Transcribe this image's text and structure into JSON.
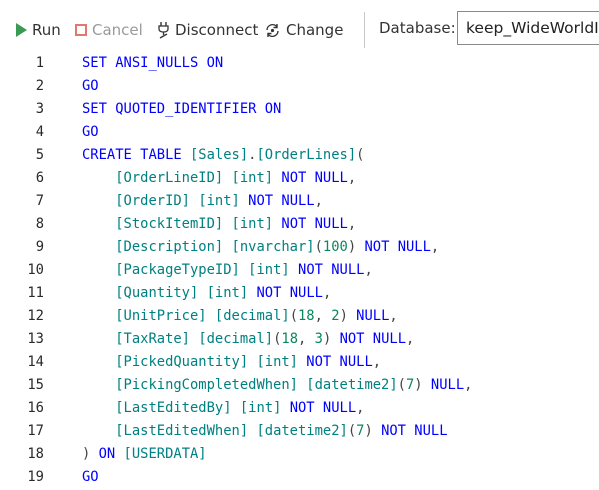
{
  "toolbar": {
    "run_label": "Run",
    "cancel_label": "Cancel",
    "disconnect_label": "Disconnect",
    "change_label": "Change",
    "database_label": "Database:",
    "database_value": "keep_WideWorldI"
  },
  "icons": {
    "run": "play-icon",
    "cancel": "stop-square-icon",
    "disconnect": "plug-disconnect-icon",
    "change": "connection-change-icon"
  },
  "colors": {
    "keyword": "#0000ff",
    "identifier": "#008080",
    "number": "#09885a",
    "run_icon": "#3a9a53",
    "cancel_icon": "#e2776e"
  },
  "editor": {
    "lines": [
      {
        "n": "1",
        "indent": "",
        "tokens": [
          {
            "t": "kw",
            "v": "SET ANSI_NULLS ON"
          }
        ]
      },
      {
        "n": "2",
        "indent": "",
        "tokens": [
          {
            "t": "kw",
            "v": "GO"
          }
        ]
      },
      {
        "n": "3",
        "indent": "",
        "tokens": [
          {
            "t": "kw",
            "v": "SET QUOTED_IDENTIFIER ON"
          }
        ]
      },
      {
        "n": "4",
        "indent": "",
        "tokens": [
          {
            "t": "kw",
            "v": "GO"
          }
        ]
      },
      {
        "n": "5",
        "indent": "",
        "tokens": [
          {
            "t": "kw",
            "v": "CREATE TABLE "
          },
          {
            "t": "id",
            "v": "[Sales]"
          },
          {
            "t": "pun",
            "v": "."
          },
          {
            "t": "id",
            "v": "[OrderLines]"
          },
          {
            "t": "pun",
            "v": "("
          }
        ]
      },
      {
        "n": "6",
        "indent": "    ",
        "tokens": [
          {
            "t": "id",
            "v": "[OrderLineID]"
          },
          {
            "t": "pun",
            "v": " "
          },
          {
            "t": "id",
            "v": "[int]"
          },
          {
            "t": "kw",
            "v": " NOT NULL"
          },
          {
            "t": "pun",
            "v": ","
          }
        ]
      },
      {
        "n": "7",
        "indent": "    ",
        "tokens": [
          {
            "t": "id",
            "v": "[OrderID]"
          },
          {
            "t": "pun",
            "v": " "
          },
          {
            "t": "id",
            "v": "[int]"
          },
          {
            "t": "kw",
            "v": " NOT NULL"
          },
          {
            "t": "pun",
            "v": ","
          }
        ]
      },
      {
        "n": "8",
        "indent": "    ",
        "tokens": [
          {
            "t": "id",
            "v": "[StockItemID]"
          },
          {
            "t": "pun",
            "v": " "
          },
          {
            "t": "id",
            "v": "[int]"
          },
          {
            "t": "kw",
            "v": " NOT NULL"
          },
          {
            "t": "pun",
            "v": ","
          }
        ]
      },
      {
        "n": "9",
        "indent": "    ",
        "tokens": [
          {
            "t": "id",
            "v": "[Description]"
          },
          {
            "t": "pun",
            "v": " "
          },
          {
            "t": "id",
            "v": "[nvarchar]"
          },
          {
            "t": "pun",
            "v": "("
          },
          {
            "t": "num",
            "v": "100"
          },
          {
            "t": "pun",
            "v": ")"
          },
          {
            "t": "kw",
            "v": " NOT NULL"
          },
          {
            "t": "pun",
            "v": ","
          }
        ]
      },
      {
        "n": "10",
        "indent": "    ",
        "tokens": [
          {
            "t": "id",
            "v": "[PackageTypeID]"
          },
          {
            "t": "pun",
            "v": " "
          },
          {
            "t": "id",
            "v": "[int]"
          },
          {
            "t": "kw",
            "v": " NOT NULL"
          },
          {
            "t": "pun",
            "v": ","
          }
        ]
      },
      {
        "n": "11",
        "indent": "    ",
        "tokens": [
          {
            "t": "id",
            "v": "[Quantity]"
          },
          {
            "t": "pun",
            "v": " "
          },
          {
            "t": "id",
            "v": "[int]"
          },
          {
            "t": "kw",
            "v": " NOT NULL"
          },
          {
            "t": "pun",
            "v": ","
          }
        ]
      },
      {
        "n": "12",
        "indent": "    ",
        "tokens": [
          {
            "t": "id",
            "v": "[UnitPrice]"
          },
          {
            "t": "pun",
            "v": " "
          },
          {
            "t": "id",
            "v": "[decimal]"
          },
          {
            "t": "pun",
            "v": "("
          },
          {
            "t": "num",
            "v": "18"
          },
          {
            "t": "pun",
            "v": ", "
          },
          {
            "t": "num",
            "v": "2"
          },
          {
            "t": "pun",
            "v": ")"
          },
          {
            "t": "kw",
            "v": " NULL"
          },
          {
            "t": "pun",
            "v": ","
          }
        ]
      },
      {
        "n": "13",
        "indent": "    ",
        "tokens": [
          {
            "t": "id",
            "v": "[TaxRate]"
          },
          {
            "t": "pun",
            "v": " "
          },
          {
            "t": "id",
            "v": "[decimal]"
          },
          {
            "t": "pun",
            "v": "("
          },
          {
            "t": "num",
            "v": "18"
          },
          {
            "t": "pun",
            "v": ", "
          },
          {
            "t": "num",
            "v": "3"
          },
          {
            "t": "pun",
            "v": ")"
          },
          {
            "t": "kw",
            "v": " NOT NULL"
          },
          {
            "t": "pun",
            "v": ","
          }
        ]
      },
      {
        "n": "14",
        "indent": "    ",
        "tokens": [
          {
            "t": "id",
            "v": "[PickedQuantity]"
          },
          {
            "t": "pun",
            "v": " "
          },
          {
            "t": "id",
            "v": "[int]"
          },
          {
            "t": "kw",
            "v": " NOT NULL"
          },
          {
            "t": "pun",
            "v": ","
          }
        ]
      },
      {
        "n": "15",
        "indent": "    ",
        "tokens": [
          {
            "t": "id",
            "v": "[PickingCompletedWhen]"
          },
          {
            "t": "pun",
            "v": " "
          },
          {
            "t": "id",
            "v": "[datetime2]"
          },
          {
            "t": "pun",
            "v": "("
          },
          {
            "t": "num",
            "v": "7"
          },
          {
            "t": "pun",
            "v": ")"
          },
          {
            "t": "kw",
            "v": " NULL"
          },
          {
            "t": "pun",
            "v": ","
          }
        ]
      },
      {
        "n": "16",
        "indent": "    ",
        "tokens": [
          {
            "t": "id",
            "v": "[LastEditedBy]"
          },
          {
            "t": "pun",
            "v": " "
          },
          {
            "t": "id",
            "v": "[int]"
          },
          {
            "t": "kw",
            "v": " NOT NULL"
          },
          {
            "t": "pun",
            "v": ","
          }
        ]
      },
      {
        "n": "17",
        "indent": "    ",
        "tokens": [
          {
            "t": "id",
            "v": "[LastEditedWhen]"
          },
          {
            "t": "pun",
            "v": " "
          },
          {
            "t": "id",
            "v": "[datetime2]"
          },
          {
            "t": "pun",
            "v": "("
          },
          {
            "t": "num",
            "v": "7"
          },
          {
            "t": "pun",
            "v": ")"
          },
          {
            "t": "kw",
            "v": " NOT NULL"
          }
        ]
      },
      {
        "n": "18",
        "indent": "",
        "tokens": [
          {
            "t": "pun",
            "v": ")"
          },
          {
            "t": "kw",
            "v": " ON "
          },
          {
            "t": "id",
            "v": "[USERDATA]"
          }
        ]
      },
      {
        "n": "19",
        "indent": "",
        "tokens": [
          {
            "t": "kw",
            "v": "GO"
          }
        ]
      }
    ]
  }
}
